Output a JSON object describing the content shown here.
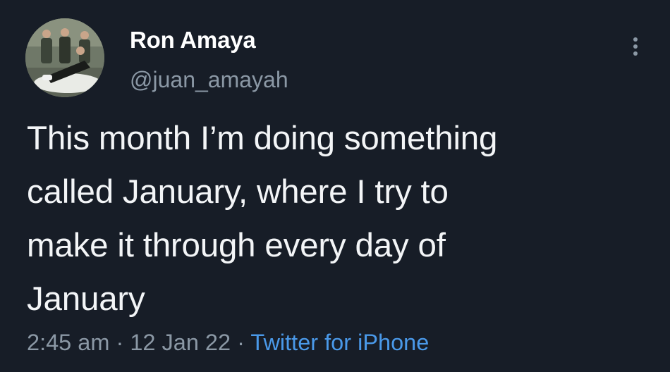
{
  "tweet": {
    "author_name": "Ron Amaya",
    "author_handle": "@juan_amayah",
    "text_lines": [
      "This month I’m doing something",
      "called January, where I try to",
      "make it through every day of",
      "January"
    ],
    "time": "2:45 am",
    "separator": "·",
    "date": "12 Jan 22",
    "source": "Twitter for iPhone"
  },
  "icons": {
    "more": "more-options-icon"
  },
  "colors": {
    "background": "#171d27",
    "text": "#f3f5f7",
    "secondary": "#8b98a5",
    "link": "#4a99e9"
  }
}
